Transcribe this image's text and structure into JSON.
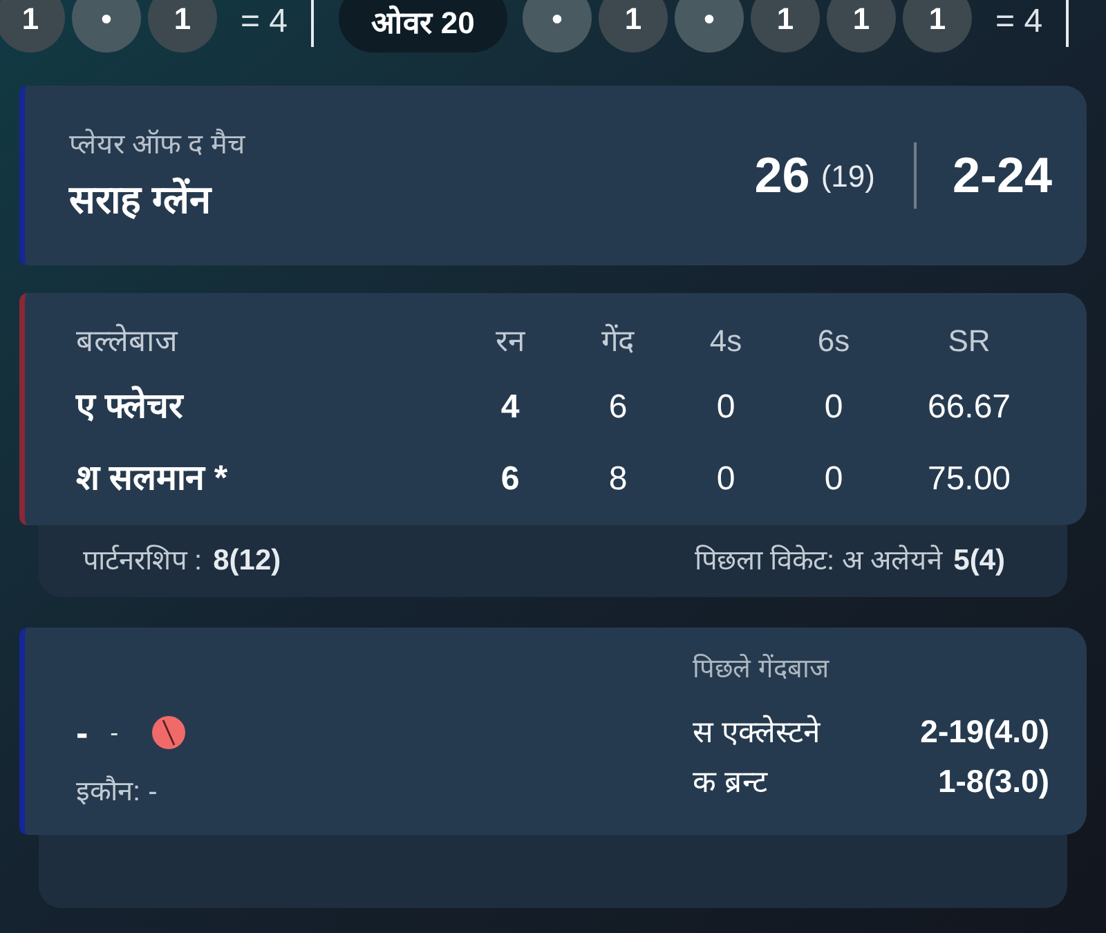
{
  "over_strip": [
    {
      "balls": [
        {
          "kind": "run",
          "label": "1"
        },
        {
          "kind": "dot",
          "label": "•"
        },
        {
          "kind": "run",
          "label": "1"
        }
      ],
      "total": "= 4"
    },
    {
      "label": "ओवर 20",
      "balls": [
        {
          "kind": "dot",
          "label": "•"
        },
        {
          "kind": "run",
          "label": "1"
        },
        {
          "kind": "dot",
          "label": "•"
        },
        {
          "kind": "run",
          "label": "1"
        },
        {
          "kind": "run",
          "label": "1"
        },
        {
          "kind": "run",
          "label": "1"
        }
      ],
      "total": "= 4"
    }
  ],
  "player_of_match": {
    "caption": "प्लेयर ऑफ द मैच",
    "name": "सराह ग्लेंन",
    "runs": "26",
    "balls": "(19)",
    "figures": "2-24"
  },
  "batting": {
    "columns": [
      "बल्लेबाज",
      "रन",
      "गेंद",
      "4s",
      "6s",
      "SR"
    ],
    "rows": [
      {
        "name": "ए फ्लेचर",
        "runs": "4",
        "balls": "6",
        "fours": "0",
        "sixes": "0",
        "strike_rate": "66.67"
      },
      {
        "name": "श सलमान *",
        "runs": "6",
        "balls": "8",
        "fours": "0",
        "sixes": "0",
        "strike_rate": "75.00"
      }
    ],
    "partnership": {
      "label": "पार्टनरशिप :",
      "value": "8(12)"
    },
    "last_wicket": {
      "label": "पिछला विकेट: अ अलेयने",
      "value": "5(4)"
    }
  },
  "bowling": {
    "current": {
      "figures": "-",
      "overs": "-",
      "economy": "इकौन: -"
    },
    "previous_title": "पिछले गेंदबाज",
    "previous": [
      {
        "name": "स एक्लेस्टने",
        "figures": "2-19(4.0)"
      },
      {
        "name": "क ब्रन्ट",
        "figures": "1-8(3.0)"
      }
    ]
  }
}
